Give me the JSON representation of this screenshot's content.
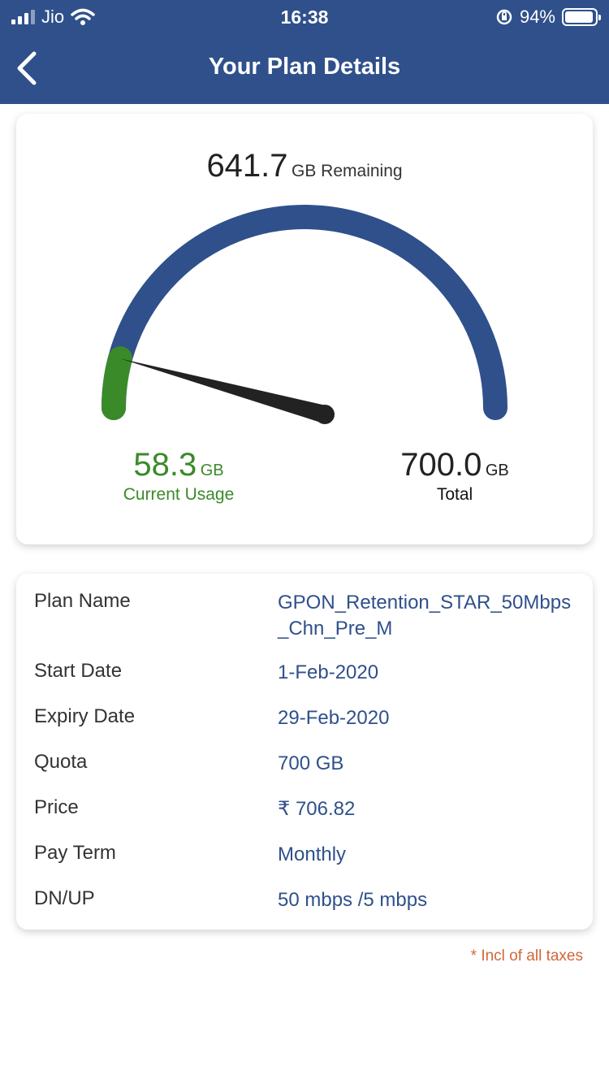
{
  "status_bar": {
    "carrier": "Jio",
    "time": "16:38",
    "battery_percent": "94%",
    "battery_level": 0.94
  },
  "header": {
    "title": "Your Plan Details",
    "back_icon": "chevron-left-icon"
  },
  "gauge": {
    "remaining_value": "641.7",
    "remaining_label": "GB Remaining",
    "usage_value": "58.3",
    "usage_unit": "GB",
    "usage_label": "Current Usage",
    "total_value": "700.0",
    "total_unit": "GB",
    "total_label": "Total",
    "used_fraction": 0.0833,
    "colors": {
      "track": "#2f508b",
      "used": "#3b8a2a",
      "needle": "#222222"
    }
  },
  "details": {
    "rows": [
      {
        "label": "Plan Name",
        "value": "GPON_Retention_STAR_50Mbps_Chn_Pre_M"
      },
      {
        "label": "Start Date",
        "value": "1-Feb-2020"
      },
      {
        "label": "Expiry Date",
        "value": "29-Feb-2020"
      },
      {
        "label": "Quota",
        "value": "700 GB"
      },
      {
        "label": "Price",
        "value": "₹ 706.82"
      },
      {
        "label": "Pay Term",
        "value": "Monthly"
      },
      {
        "label": "DN/UP",
        "value": "50 mbps /5 mbps"
      }
    ]
  },
  "footnote": "* Incl of all taxes"
}
